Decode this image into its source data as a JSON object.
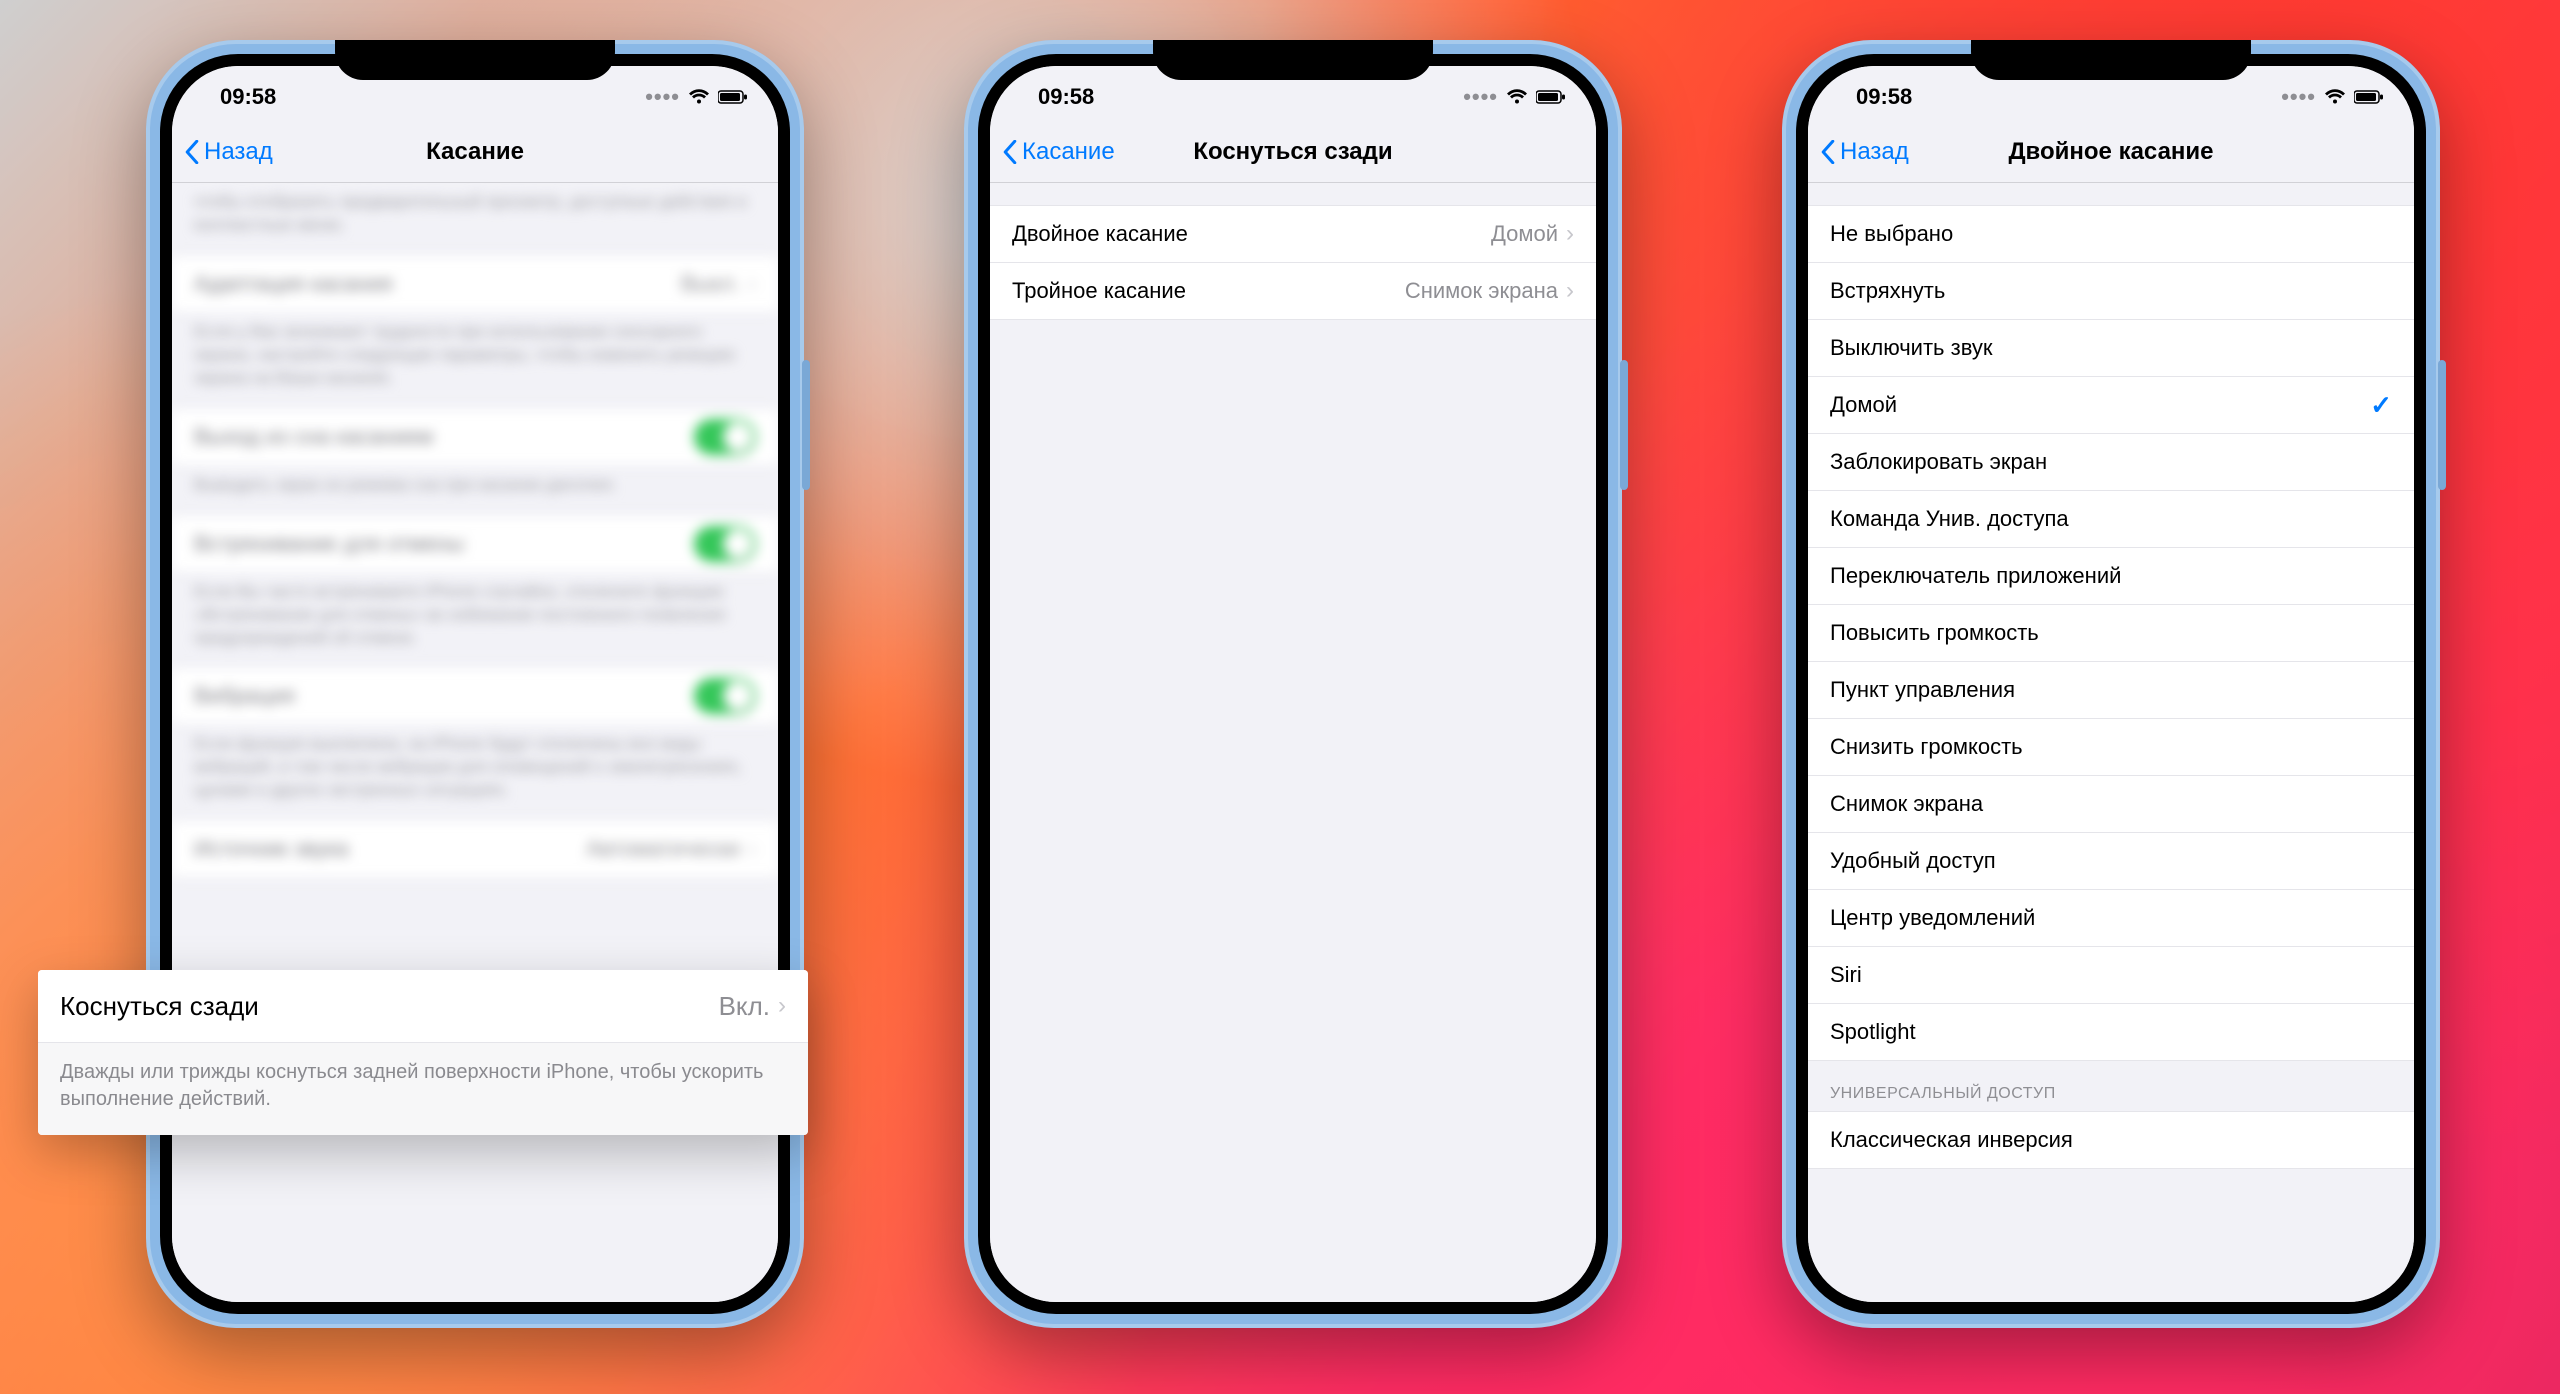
{
  "status": {
    "time": "09:58",
    "signal_dots": "••••"
  },
  "phone1": {
    "back": "Назад",
    "title": "Касание",
    "blur": {
      "desc0": "чтобы отобразить предварительный просмотр, доступные действия и контекстные меню.",
      "row1_label": "Адаптация касания",
      "row1_value": "Выкл.",
      "desc1": "Если у Вас возникают трудности при использовании сенсорного экрана, настройте следующие параметры, чтобы изменить реакцию экрана на Ваши касания.",
      "row2_label": "Выход из сна касанием",
      "desc2": "Выводить экран из режима сна при касании дисплея.",
      "row3_label": "Встряхивание для отмены",
      "desc3": "Если Вы часто встряхиваете iPhone случайно, отключите функцию «Встряхивание для отмены» во избежание постоянного появления предупреждений об отмене.",
      "row4_label": "Вибрация",
      "desc4": "Если функция выключена, на iPhone будут отключены все виды вибраций, в том числе вибрации для оповещений о землетрясениях, цунами и других экстренных ситуациях.",
      "row5_label": "Источник звука",
      "row5_value": "Автоматически"
    },
    "popout": {
      "label": "Коснуться сзади",
      "value": "Вкл.",
      "note": "Дважды или трижды коснуться задней поверхности iPhone, чтобы ускорить выполнение действий."
    }
  },
  "phone2": {
    "back": "Касание",
    "title": "Коснуться сзади",
    "rows": [
      {
        "label": "Двойное касание",
        "value": "Домой"
      },
      {
        "label": "Тройное касание",
        "value": "Снимок экрана"
      }
    ]
  },
  "phone3": {
    "back": "Назад",
    "title": "Двойное касание",
    "options": [
      "Не выбрано",
      "Встряхнуть",
      "Выключить звук",
      "Домой",
      "Заблокировать экран",
      "Команда Унив. доступа",
      "Переключатель приложений",
      "Повысить громкость",
      "Пункт управления",
      "Снизить громкость",
      "Снимок экрана",
      "Удобный доступ",
      "Центр уведомлений",
      "Siri",
      "Spotlight"
    ],
    "selected_index": 3,
    "section2_header": "УНИВЕРСАЛЬНЫЙ ДОСТУП",
    "section2_first": "Классическая инверсия"
  }
}
